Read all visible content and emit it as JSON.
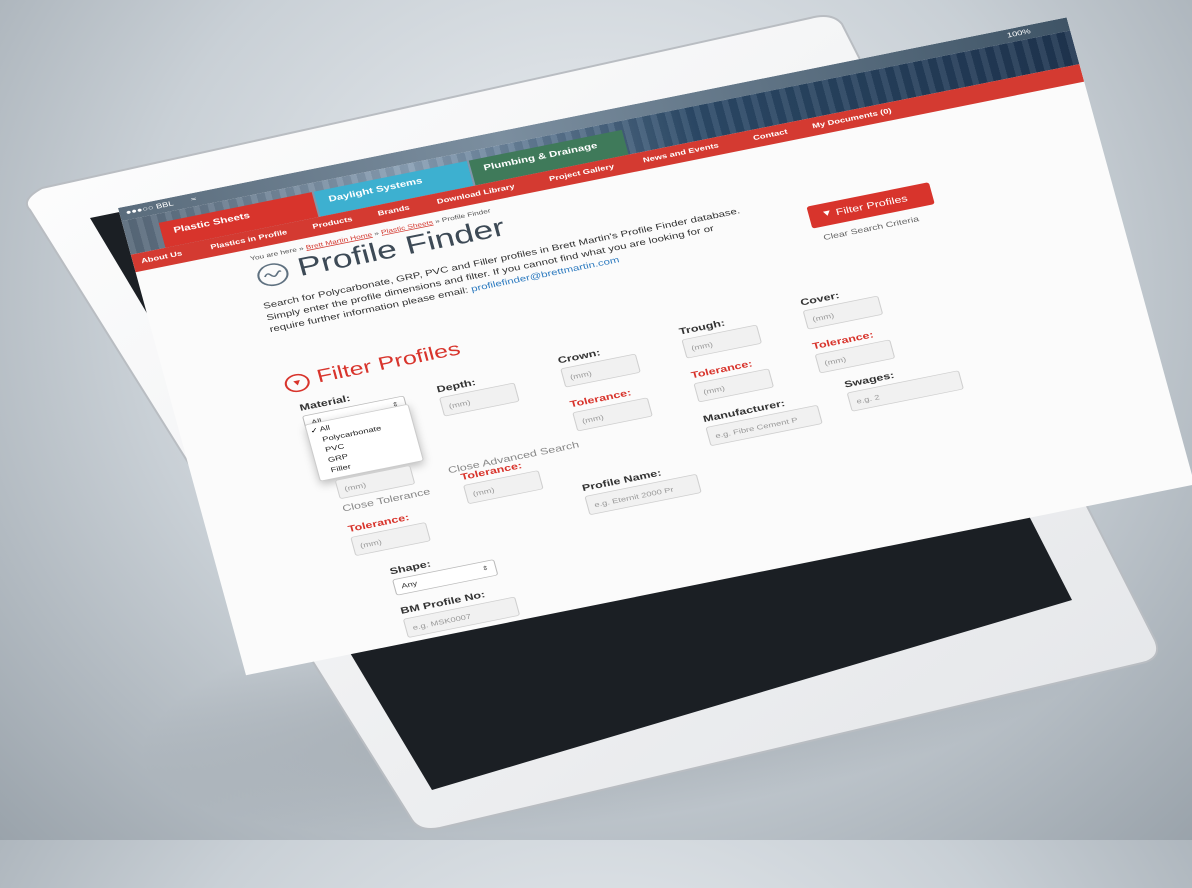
{
  "status": {
    "carrier": "●●●○○ BBL",
    "wifi": "wifi-icon",
    "battery": "100%"
  },
  "tabs": [
    {
      "label": "Plastic Sheets"
    },
    {
      "label": "Daylight Systems"
    },
    {
      "label": "Plumbing & Drainage"
    }
  ],
  "nav": [
    "About Us",
    "Plastics in Profile",
    "Products",
    "Brands",
    "Download Library",
    "Project Gallery",
    "News and Events",
    "Contact",
    "My Documents (0)"
  ],
  "breadcrumb": {
    "prefix": "You are here »",
    "home": "Brett Martin Home",
    "sep1": "»",
    "section": "Plastic Sheets",
    "current": "» Profile Finder"
  },
  "page": {
    "title": "Profile Finder",
    "intro": "Search for Polycarbonate, GRP, PVC and Filler profiles in Brett Martin's Profile Finder database. Simply enter the profile dimensions and filter. If you cannot find what you are looking for or require further information please email:",
    "email": "profilefinder@brettmartin.com",
    "filter_button": "Filter Profiles",
    "clear_link": "Clear Search Criteria",
    "section_title": "Filter Profiles"
  },
  "form": {
    "material_label": "Material:",
    "material_selected": "All",
    "material_options": [
      "All",
      "Polycarbonate",
      "PVC",
      "GRP",
      "Filler"
    ],
    "depth_label": "Depth:",
    "crown_label": "Crown:",
    "trough_label": "Trough:",
    "cover_label": "Cover:",
    "tolerance_label": "Tolerance:",
    "mm_placeholder": "(mm)",
    "close_tolerance": "Close Tolerance",
    "close_advanced": "Close Advanced Search",
    "manufacturer_label": "Manufacturer:",
    "manufacturer_placeholder": "e.g. Fibre Cement P",
    "swages_label": "Swages:",
    "swages_placeholder": "e.g. 2",
    "profile_name_label": "Profile Name:",
    "profile_name_placeholder": "e.g. Eternit 2000 Pr",
    "shape_label": "Shape:",
    "shape_selected": "Any",
    "bm_label": "BM Profile No:",
    "bm_placeholder": "e.g. MSK0007"
  }
}
